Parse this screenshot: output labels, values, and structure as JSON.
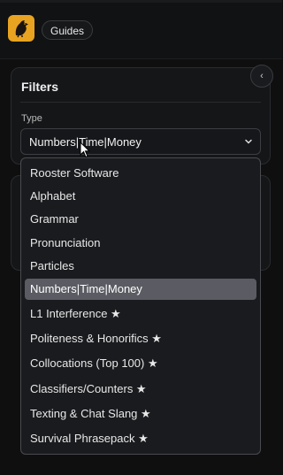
{
  "header": {
    "logo_icon": "rooster-logo-icon",
    "guides_label": "Guides"
  },
  "filters": {
    "title": "Filters",
    "collapse_icon": "chevron-left-icon",
    "type_label": "Type",
    "type_selected": "Numbers|Time|Money"
  },
  "dropdown": {
    "options": [
      "Rooster Software",
      "Alphabet",
      "Grammar",
      "Pronunciation",
      "Particles",
      "Numbers|Time|Money",
      "L1 Interference ★",
      "Politeness & Honorifics ★",
      "Collocations (Top 100) ★",
      "Classifiers/Counters ★",
      "Texting & Chat Slang ★",
      "Survival Phrasepack ★"
    ],
    "selected_index": 5
  },
  "colors": {
    "accent": "#e8a321",
    "selected_bg": "#5a5b63",
    "background": "#0f0f10"
  }
}
